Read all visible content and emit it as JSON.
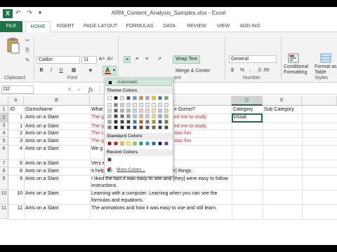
{
  "window": {
    "title": "ARM_Content_Analysis_Samples.xlsx - Excel",
    "logo": "X",
    "quick_access": "↶ ↷ ▾"
  },
  "tabs": [
    "FILE",
    "HOME",
    "INSERT",
    "PAGE LAYOUT",
    "FORMULAS",
    "DATA",
    "REVIEW",
    "VIEW",
    "ADD-INS"
  ],
  "ribbon": {
    "font_name": "Calibri",
    "font_size": "11",
    "wrap_text": "Wrap Text",
    "merge_center": "Merge & Center",
    "number_format": "General",
    "conditional_formatting": "Conditional Formatting",
    "format_as_table": "Format as Table",
    "group_clipboard": "Clipboard",
    "group_font": "Font",
    "group_alignment": "ent",
    "group_number": "Number",
    "group_styles": "Styles",
    "dollar": "$",
    "percent": "%",
    "comma": ",",
    "dec_inc": ".0 .00",
    "bold": "B",
    "italic": "I",
    "underline": "U",
    "font_color_letter": "A",
    "grow": "A˄",
    "shrink": "A˅"
  },
  "formula_bar": {
    "name_box": "D2",
    "fx": "fx",
    "cancel": "✕",
    "enter": "✓"
  },
  "sheet": {
    "columns": [
      "A",
      "B",
      "C",
      "D",
      "E"
    ],
    "headers": {
      "A": "ID",
      "B": "GizmoName",
      "C_left": "What",
      "C_right": "e Gizmo?",
      "D": "Category",
      "E": "Sub Category"
    },
    "rows": [
      {
        "num": "2",
        "id": "1",
        "name": "Ants on a Slant",
        "left": "The g",
        "right": "ed me to study.",
        "red": true,
        "category": "Visual"
      },
      {
        "num": "3",
        "id": "1",
        "name": "Ants on a Slant",
        "left": "The g",
        "right": "ed me to study.",
        "red": true,
        "category": ""
      },
      {
        "num": "4",
        "id": "2",
        "name": "Ants on a Slant",
        "left": "The c",
        "right": "was fun.",
        "red": true,
        "category": ""
      },
      {
        "num": "5",
        "id": "3",
        "name": "Ants on a Slant",
        "left": "The g",
        "right": "was fun.",
        "red": true,
        "category": ""
      },
      {
        "num": "6",
        "id": "4",
        "name": "Ants on a Slant",
        "text": "We g                         easier to do than real life.",
        "red": false,
        "category": ""
      },
      {
        "num": "7",
        "id": "6",
        "name": "Ants on a Slant",
        "text": "Very easy to use.",
        "red": false,
        "category": ""
      },
      {
        "num": "8",
        "id": "8",
        "name": "Ants on a Slant",
        "text": "It helps visual learners who like to [see] things.",
        "red": false,
        "category": ""
      },
      {
        "num": "9",
        "id": "9",
        "name": "Ants on a Slant",
        "text": "I liked the fact it was easy to see and [they] were easy to follow instructions.",
        "red": false,
        "category": ""
      },
      {
        "num": "10",
        "id": "10",
        "name": "Ants on a Slant",
        "text": "Learning with a computer.  Learning when you can see the formulas and equations.",
        "red": false,
        "category": ""
      },
      {
        "num": "11",
        "id": "11",
        "name": "Ants on a Slant",
        "text": "The animations and how it was easy to use and still learn.",
        "red": false,
        "category": ""
      }
    ]
  },
  "color_picker": {
    "automatic": "Automatic",
    "theme_colors": "Theme Colors",
    "standard_colors": "Standard Colors",
    "recent_colors": "Recent Colors",
    "more_colors": "More Colors...",
    "theme_top": [
      "#ffffff",
      "#000000",
      "#e7e6e6",
      "#44546a",
      "#5b9bd5",
      "#ed7d31",
      "#a5a5a5",
      "#ffc000",
      "#4472c4",
      "#70ad47"
    ],
    "theme_shades": [
      [
        "#f2f2f2",
        "#808080",
        "#d0cece",
        "#d6dce4",
        "#deebf6",
        "#fbe5d5",
        "#ededed",
        "#fff2cc",
        "#dae3f3",
        "#e2efd9"
      ],
      [
        "#d8d8d8",
        "#595959",
        "#aeabab",
        "#adb9ca",
        "#bdd7ee",
        "#f8cbad",
        "#dbdbdb",
        "#fee599",
        "#b4c7e7",
        "#c5e0b3"
      ],
      [
        "#bfbfbf",
        "#404040",
        "#757070",
        "#8496b0",
        "#9dc3e6",
        "#f4b183",
        "#c9c9c9",
        "#ffd966",
        "#8faadc",
        "#a8d08d"
      ],
      [
        "#a5a5a5",
        "#262626",
        "#3a3838",
        "#323f4f",
        "#2e75b5",
        "#c55a11",
        "#7b7b7b",
        "#bf9000",
        "#2f5496",
        "#538135"
      ],
      [
        "#7f7f7f",
        "#0d0d0d",
        "#171616",
        "#222a35",
        "#1e4e79",
        "#833c0b",
        "#525252",
        "#7f6000",
        "#1f3864",
        "#375623"
      ]
    ],
    "standard": [
      "#c00000",
      "#ff0000",
      "#ffc000",
      "#ffff00",
      "#92d050",
      "#00b050",
      "#00b0f0",
      "#0070c0",
      "#002060",
      "#7030a0"
    ],
    "recent": [
      "#375623"
    ]
  }
}
